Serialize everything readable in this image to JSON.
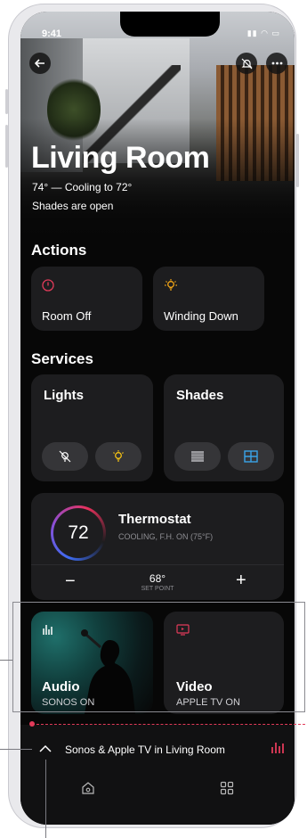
{
  "status": {
    "time": "9:41",
    "icons": "▮▮ ◠ ▭"
  },
  "header": {
    "back_icon": "arrow-left-icon",
    "mute_icon": "bell-off-icon",
    "more_icon": "ellipsis-icon"
  },
  "room": {
    "title": "Living Room",
    "climate": "74° — Cooling to 72°",
    "shades": "Shades are open"
  },
  "actions": {
    "heading": "Actions",
    "items": [
      {
        "label": "Room Off",
        "icon": "power-icon",
        "color": "#e23b5a"
      },
      {
        "label": "Winding Down",
        "icon": "bulb-icon",
        "color": "#f2a516"
      }
    ]
  },
  "services": {
    "heading": "Services",
    "lights": {
      "title": "Lights",
      "off_icon": "bulb-off-icon",
      "on_icon": "bulb-on-icon",
      "accent": "#f2c014"
    },
    "shades": {
      "title": "Shades",
      "closed_icon": "shade-closed-icon",
      "open_icon": "shade-open-icon",
      "accent": "#3aa3e8"
    }
  },
  "thermostat": {
    "value": "72",
    "title": "Thermostat",
    "subtitle": "COOLING, F.H. ON (75°F)",
    "minus": "−",
    "plus": "+",
    "setpoint_value": "68°",
    "setpoint_label": "SET POINT"
  },
  "media": {
    "audio": {
      "title": "Audio",
      "status": "SONOS ON",
      "icon": "equalizer-icon"
    },
    "video": {
      "title": "Video",
      "status": "APPLE TV ON",
      "icon": "tv-icon",
      "color": "#e23b5a"
    }
  },
  "now_playing": {
    "text": "Sonos & Apple TV in Living Room",
    "expand_icon": "chevron-up-icon",
    "bars_icon": "equalizer-icon",
    "color": "#e23b5a"
  },
  "tabbar": {
    "home_icon": "home-icon",
    "grid_icon": "grid-icon"
  }
}
